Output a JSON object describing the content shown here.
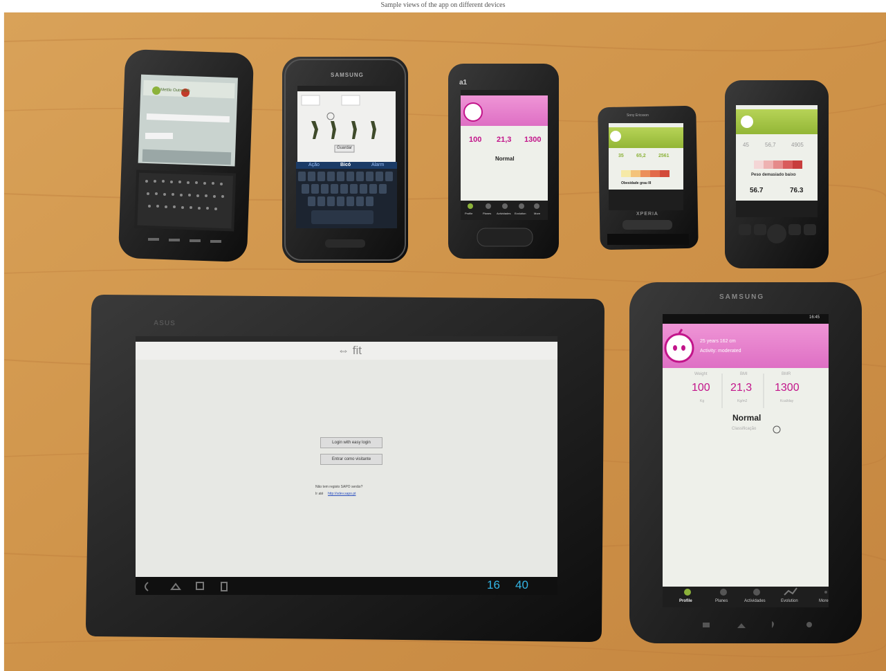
{
  "caption": "Sample views of the app on different devices",
  "colors": {
    "wood": "#d29a52",
    "wood_dark": "#b37836",
    "pink": "#e27ccb",
    "pink_text": "#c2148a",
    "green": "#a3c43e",
    "screen_light": "#eef0ea",
    "device": "#1a1a1a"
  },
  "devices": {
    "phone1": {
      "brand": "",
      "screen": "login",
      "title": "Mettle Outreach"
    },
    "phone2": {
      "brand": "SAMSUNG",
      "screen": "activity",
      "button": "Guardar",
      "bar": [
        "Ação",
        "Bicó",
        "Alarm"
      ]
    },
    "phone3": {
      "brand": "a1",
      "stats": [
        "100",
        "21,3",
        "1300"
      ],
      "status": "Normal",
      "tabs": [
        "Profile",
        "Planes",
        "Actividades",
        "Evolution",
        "More"
      ]
    },
    "phone4": {
      "brand": "Sony Ericsson",
      "stats": [
        "35",
        "65,2",
        "2561"
      ],
      "status": "Obesidade grau III",
      "footer": "XPERIA"
    },
    "phone5": {
      "brand": "",
      "stats": [
        "45",
        "56,7",
        "4905"
      ],
      "status": "Peso demasiado baixo",
      "range": [
        "56.7",
        "76.3"
      ]
    },
    "tablet1": {
      "brand": "ASUS",
      "app_logo": "⇔ fit",
      "buttons": [
        "Login with easy login",
        "Entrar como visitante"
      ],
      "note": "Não tem registo SAPO senão?",
      "link": "http://sdev.sapo.pt",
      "note_prefix": "Ir até",
      "clock_hour": "16",
      "clock_min": "40"
    },
    "tablet2": {
      "brand": "SAMSUNG",
      "time": "16:45",
      "header_lines": [
        "25 years   162 cm",
        "Activity: moderated"
      ],
      "stats": [
        {
          "label": "Weight",
          "value": "100",
          "unit": "Kg"
        },
        {
          "label": "BMI",
          "value": "21,3",
          "unit": "Kg/m2"
        },
        {
          "label": "BMR",
          "value": "1300",
          "unit": "Kcal/day"
        }
      ],
      "status": "Normal",
      "sub_status": "Classificação",
      "tabs": [
        "Profile",
        "Planes",
        "Actividades",
        "Evolution",
        "More"
      ]
    }
  }
}
